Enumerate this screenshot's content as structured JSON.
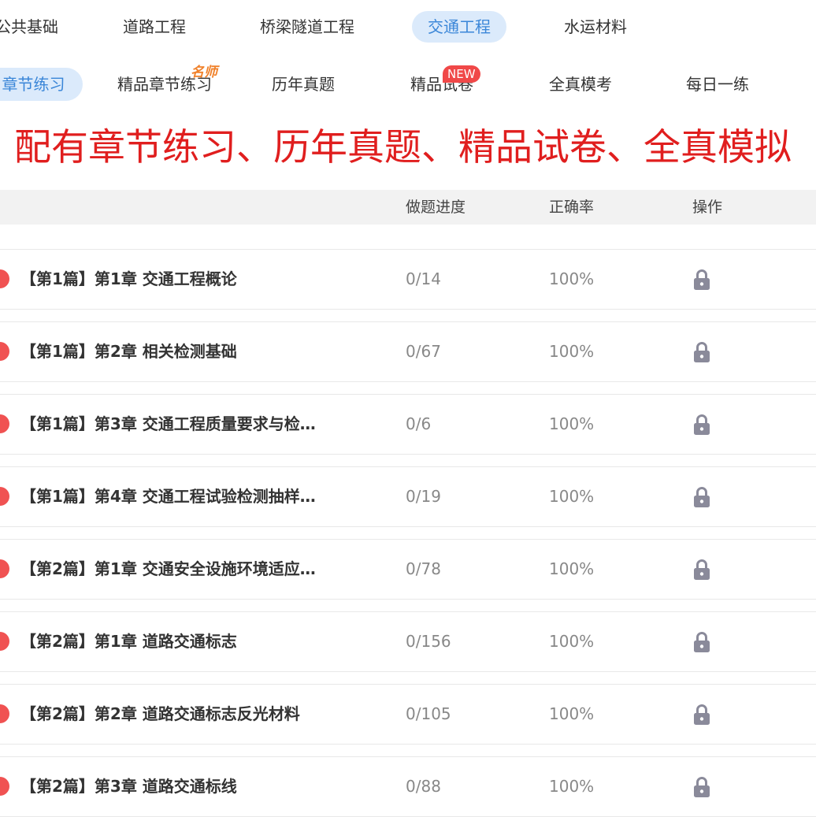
{
  "subjects": [
    {
      "label": "公共基础",
      "active": false
    },
    {
      "label": "道路工程",
      "active": false
    },
    {
      "label": "桥梁隧道工程",
      "active": false
    },
    {
      "label": "交通工程",
      "active": true
    },
    {
      "label": "水运材料",
      "active": false
    }
  ],
  "modes": [
    {
      "label": "章节练习",
      "active": true
    },
    {
      "label": "精品章节练习",
      "badge": "名师"
    },
    {
      "label": "历年真题"
    },
    {
      "label": "精品试卷",
      "badge": "NEW"
    },
    {
      "label": "全真模考"
    },
    {
      "label": "每日一练"
    }
  ],
  "banner": "配有章节练习、历年真题、精品试卷、全真模拟",
  "table": {
    "columns": {
      "progress": "做题进度",
      "accuracy": "正确率",
      "action": "操作"
    },
    "rows": [
      {
        "name": "【第1篇】第1章 交通工程概论",
        "progress": "0/14",
        "accuracy": "100%"
      },
      {
        "name": "【第1篇】第2章 相关检测基础",
        "progress": "0/67",
        "accuracy": "100%"
      },
      {
        "name": "【第1篇】第3章 交通工程质量要求与检…",
        "progress": "0/6",
        "accuracy": "100%"
      },
      {
        "name": "【第1篇】第4章 交通工程试验检测抽样…",
        "progress": "0/19",
        "accuracy": "100%"
      },
      {
        "name": "【第2篇】第1章 交通安全设施环境适应…",
        "progress": "0/78",
        "accuracy": "100%"
      },
      {
        "name": "【第2篇】第1章 道路交通标志",
        "progress": "0/156",
        "accuracy": "100%"
      },
      {
        "name": "【第2篇】第2章 道路交通标志反光材料",
        "progress": "0/105",
        "accuracy": "100%"
      },
      {
        "name": "【第2篇】第3章 道路交通标线",
        "progress": "0/88",
        "accuracy": "100%"
      }
    ]
  },
  "icons": {
    "row_action": "lock-icon"
  },
  "colors": {
    "accent": "#3a86d8",
    "active_bg": "#dbeafb",
    "banner_text": "#e01e1e",
    "dot": "#f05252",
    "new_badge": "#f04848",
    "famous_badge": "#f0812a",
    "lock": "#8a8a9a"
  }
}
